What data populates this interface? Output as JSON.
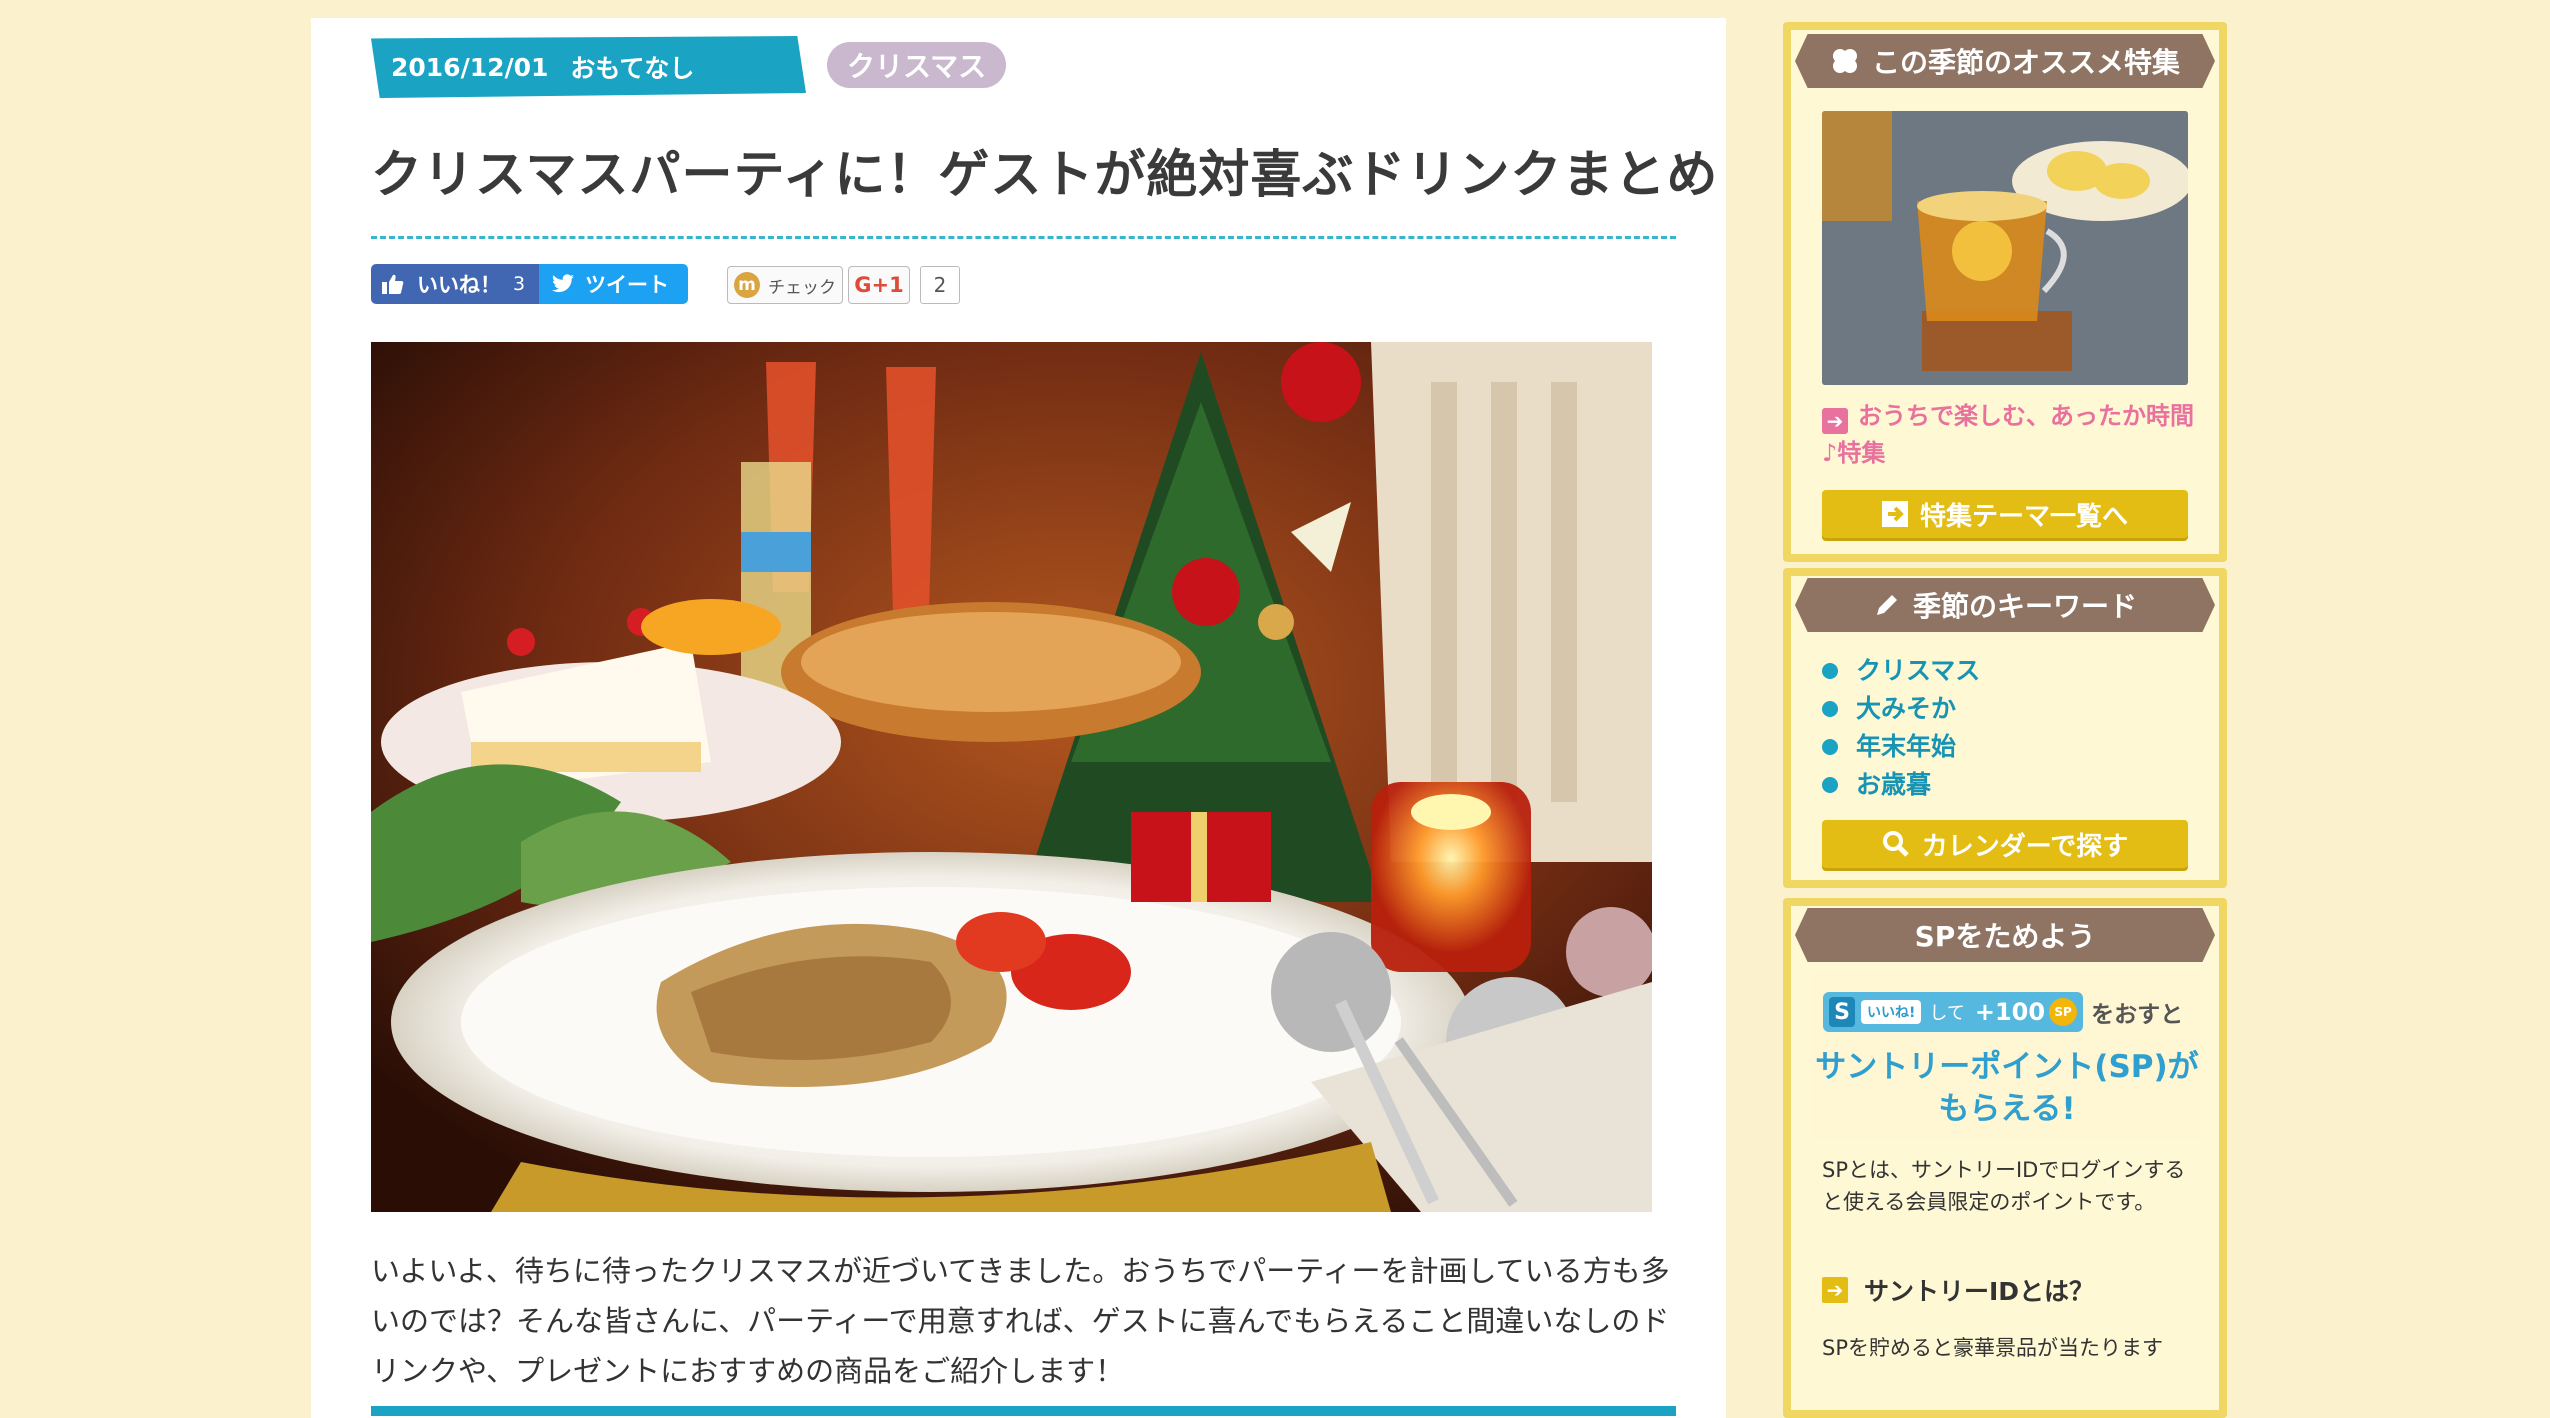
{
  "article": {
    "date": "2016/12/01",
    "category": "おもてなし",
    "tag": "クリスマス",
    "title": "クリスマスパーティに！ゲストが絶対喜ぶドリンクまとめ",
    "intro": "いよいよ、待ちに待ったクリスマスが近づいてきました。おうちでパーティーを計画している方も多いのでは？そんな皆さんに、パーティーで用意すれば、ゲストに喜んでもらえること間違いなしのドリンクや、プレゼントにおすすめの商品をご紹介します！"
  },
  "social": {
    "like_label": "いいね！",
    "like_count": "3",
    "tweet_label": "ツイート",
    "mixi_label": "チェック",
    "gplus_label": "G+1",
    "gplus_count": "2"
  },
  "sidebar": {
    "feature": {
      "heading": "この季節のオススメ特集",
      "link_text": "おうちで楽しむ、あったか時間♪特集",
      "button": "特集テーマ一覧へ"
    },
    "keywords": {
      "heading": "季節のキーワード",
      "items": [
        "クリスマス",
        "大みそか",
        "年末年始",
        "お歳暮"
      ],
      "button": "カレンダーで探す"
    },
    "sp": {
      "heading": "SPをためよう",
      "pill_s": "S",
      "pill_like": "いいね!",
      "pill_shite": "して",
      "pill_points": "+100",
      "pill_coin": "SP",
      "osuto": "をおすと",
      "headline": "サントリーポイント(SP)がもらえる!",
      "description": "SPとは、サントリーIDでログインすると使える会員限定のポイントです。",
      "id_link": "サントリーIDとは？",
      "description2": "SPを貯めると豪華景品が当たります"
    }
  },
  "colors": {
    "accent_blue": "#1aa3c2",
    "sidebar_frame": "#f0d763",
    "button_yellow": "#e4bd14",
    "heading_brown": "#8f7463",
    "feature_pink": "#e8719d"
  }
}
